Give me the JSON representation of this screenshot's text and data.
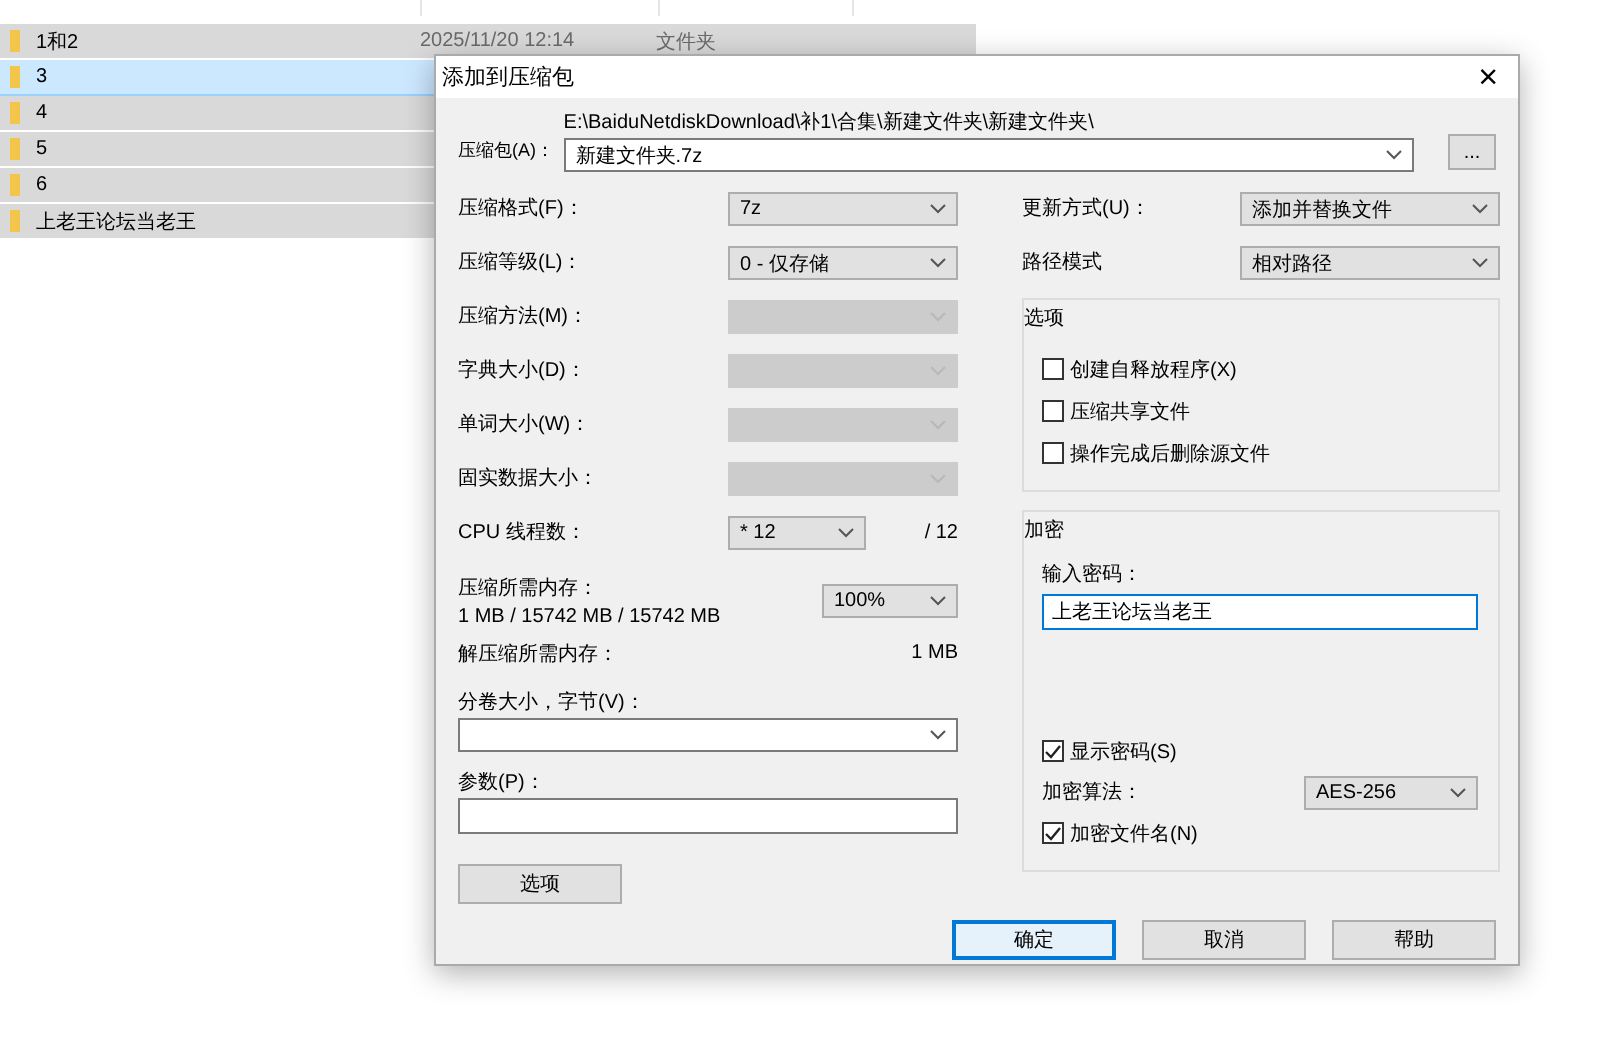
{
  "explorer": {
    "rows": [
      {
        "name": "1和2",
        "date": "2025/11/20 12:14",
        "type": "文件夹",
        "selected": true,
        "focused": false
      },
      {
        "name": "3",
        "selected": true,
        "focused": true
      },
      {
        "name": "4",
        "selected": true,
        "focused": false
      },
      {
        "name": "5",
        "selected": true,
        "focused": false
      },
      {
        "name": "6",
        "selected": true,
        "focused": false
      },
      {
        "name": "上老王论坛当老王",
        "selected": true,
        "focused": false
      }
    ]
  },
  "dialog": {
    "title": "添加到压缩包",
    "close": "×",
    "archive": {
      "label": "压缩包(A)：",
      "path": "E:\\BaiduNetdiskDownload\\补1\\合集\\新建文件夹\\新建文件夹\\",
      "value": "新建文件夹.7z",
      "browse": "..."
    },
    "left_rows": [
      {
        "kind": "select",
        "label": "压缩格式(F)：",
        "value": "7z",
        "disabled": false
      },
      {
        "kind": "select",
        "label": "压缩等级(L)：",
        "value": "0 - 仅存储",
        "disabled": false
      },
      {
        "kind": "select",
        "label": "压缩方法(M)：",
        "disabled": true
      },
      {
        "kind": "select",
        "label": "字典大小(D)：",
        "disabled": true
      },
      {
        "kind": "select",
        "label": "单词大小(W)：",
        "disabled": true
      },
      {
        "kind": "select",
        "label": "固实数据大小：",
        "disabled": true
      },
      {
        "kind": "threads",
        "label": "CPU 线程数：",
        "value": "* 12",
        "max": "/ 12"
      },
      {
        "kind": "memory",
        "label": "压缩所需内存：",
        "usage": "1 MB / 15742 MB / 15742 MB",
        "value": "100%"
      },
      {
        "kind": "info",
        "label": "解压缩所需内存：",
        "value": "1 MB"
      }
    ],
    "volume": {
      "label": "分卷大小，字节(V)："
    },
    "parameters": {
      "label": "参数(P)："
    },
    "options_button": "选项",
    "update": {
      "label": "更新方式(U)：",
      "value": "添加并替换文件"
    },
    "path_mode": {
      "label": "路径模式",
      "value": "相对路径"
    },
    "options_group": {
      "title": "选项",
      "items": [
        {
          "label": "创建自释放程序(X)",
          "checked": false
        },
        {
          "label": "压缩共享文件",
          "checked": false
        },
        {
          "label": "操作完成后删除源文件",
          "checked": false
        }
      ]
    },
    "encryption": {
      "title": "加密",
      "password_label": "输入密码：",
      "password": "上老王论坛当老王",
      "show_password": {
        "label": "显示密码(S)",
        "checked": true
      },
      "method": {
        "label": "加密算法：",
        "value": "AES-256"
      },
      "encrypt_names": {
        "label": "加密文件名(N)",
        "checked": true
      }
    },
    "buttons": [
      {
        "label": "确定",
        "default": true
      },
      {
        "label": "取消",
        "default": false
      },
      {
        "label": "帮助",
        "default": false
      }
    ]
  }
}
